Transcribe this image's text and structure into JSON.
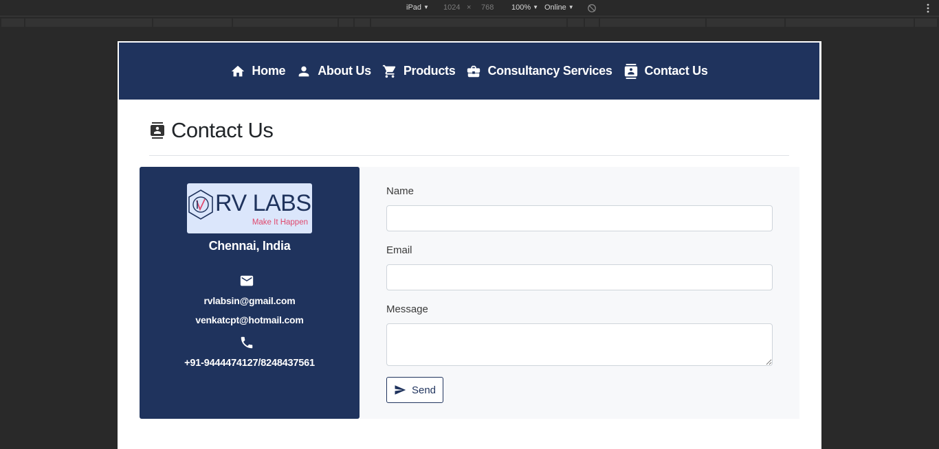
{
  "devtools": {
    "device": "iPad",
    "width": "1024",
    "times": "×",
    "height": "768",
    "zoom": "100%",
    "network": "Online"
  },
  "nav": {
    "items": [
      {
        "label": "Home",
        "icon": "home-icon"
      },
      {
        "label": "About Us",
        "icon": "person-icon"
      },
      {
        "label": "Products",
        "icon": "cart-icon"
      },
      {
        "label": "Consultancy Services",
        "icon": "briefcase-icon"
      },
      {
        "label": "Contact Us",
        "icon": "contact-book-icon"
      }
    ]
  },
  "page": {
    "title": "Contact Us"
  },
  "contact": {
    "logo_text": "RV LABS",
    "logo_tagline": "Make It Happen",
    "city": "Chennai, India",
    "email_primary": "rvlabsin@gmail.com",
    "email_secondary": "venkatcpt@hotmail.com",
    "phone": "+91-9444474127/8248437561"
  },
  "form": {
    "name_label": "Name",
    "name_value": "",
    "email_label": "Email",
    "email_value": "",
    "message_label": "Message",
    "message_value": "",
    "send_label": "Send"
  },
  "colors": {
    "brand_navy": "#1f335d",
    "logo_bg": "#dbe6fb",
    "tagline_pink": "#e0486d",
    "form_bg": "#f7f8fa"
  }
}
